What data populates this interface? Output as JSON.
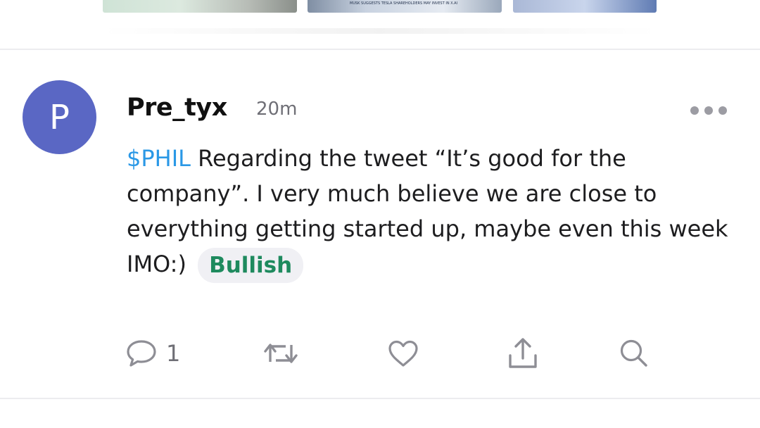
{
  "media_strip": {
    "thumbnail_2_caption": "MUSK SUGGESTS TESLA SHAREHOLDERS MAY INVEST IN X.AI"
  },
  "post": {
    "avatar_initial": "P",
    "username": "Pre_tyx",
    "timestamp": "20m",
    "ticker": "$PHIL",
    "text": " Regarding the tweet “It’s good for the company”. I very much believe we are close to everything getting started up, maybe even this week IMO:)",
    "sentiment": "Bullish",
    "avatar_color": "#5a67c4",
    "ticker_color": "#2a98e6",
    "sentiment_color": "#1e8a5e"
  },
  "actions": {
    "comment_count": "1",
    "icons": [
      "comment-icon",
      "repost-icon",
      "like-icon",
      "share-icon",
      "search-icon"
    ]
  },
  "menu": {
    "icon": "more-options-icon"
  }
}
